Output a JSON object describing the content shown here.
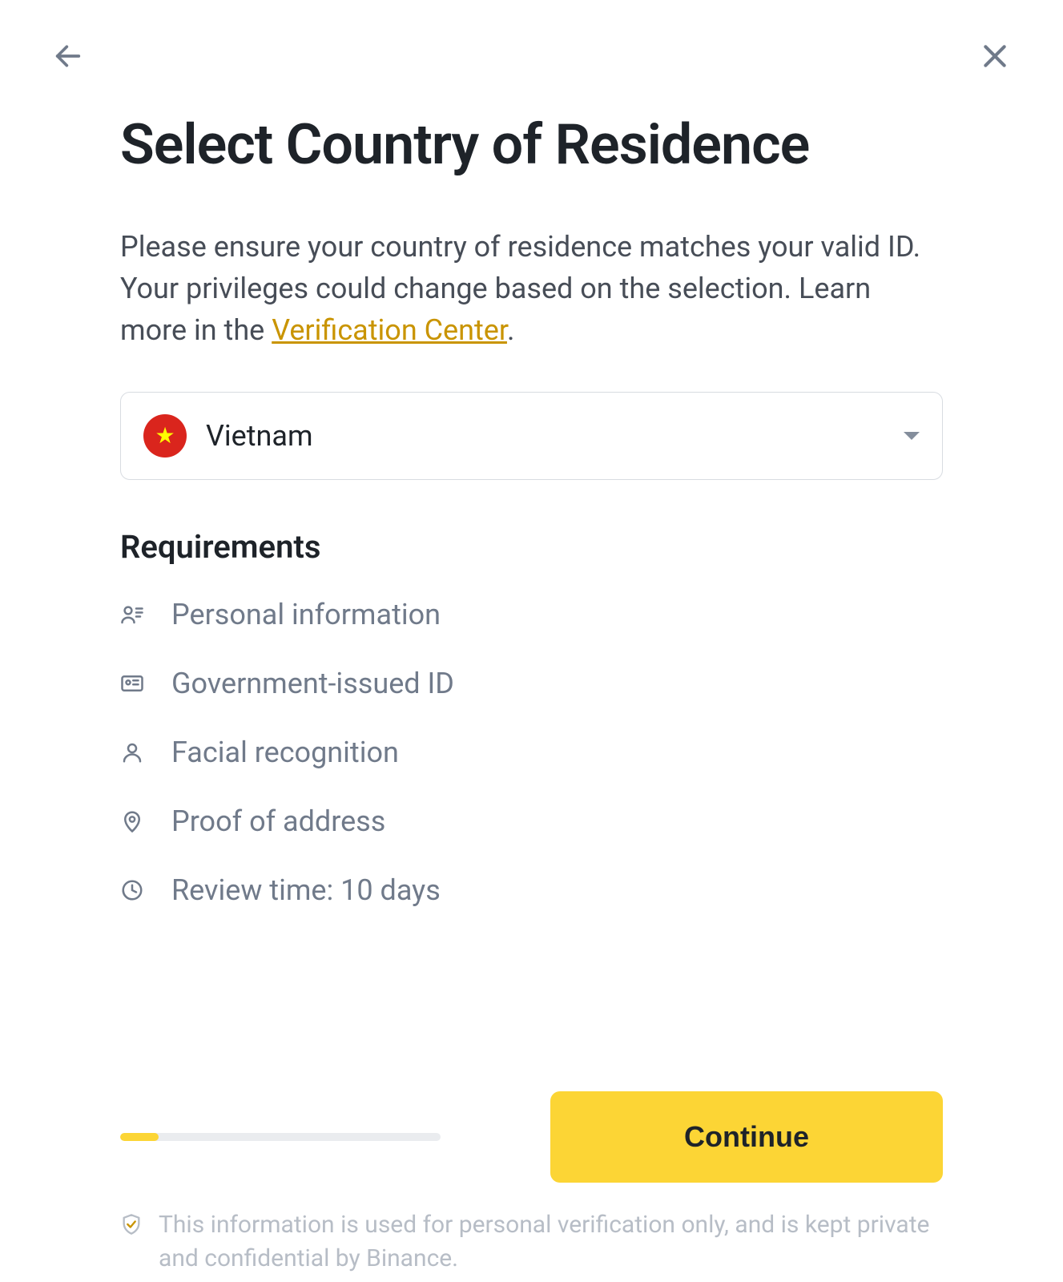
{
  "title": "Select Country of Residence",
  "subtitle_pre": "Please ensure your country of residence matches your valid ID. Your privileges could change based on the selection. Learn more in the ",
  "subtitle_link": "Verification Center",
  "subtitle_post": ".",
  "selected_country": "Vietnam",
  "requirements_title": "Requirements",
  "requirements": [
    {
      "icon": "person-lines-icon",
      "label": "Personal information"
    },
    {
      "icon": "id-card-icon",
      "label": "Government-issued ID"
    },
    {
      "icon": "person-icon",
      "label": "Facial recognition"
    },
    {
      "icon": "pin-icon",
      "label": "Proof of address"
    },
    {
      "icon": "clock-icon",
      "label": "Review time: 10 days"
    }
  ],
  "continue_label": "Continue",
  "disclaimer": "This information is used for personal verification only, and is kept private and confidential by Binance.",
  "progress_percent": 12,
  "colors": {
    "accent": "#fcd535",
    "link": "#C99400",
    "text": "#1e2329",
    "muted": "#707a8a"
  }
}
